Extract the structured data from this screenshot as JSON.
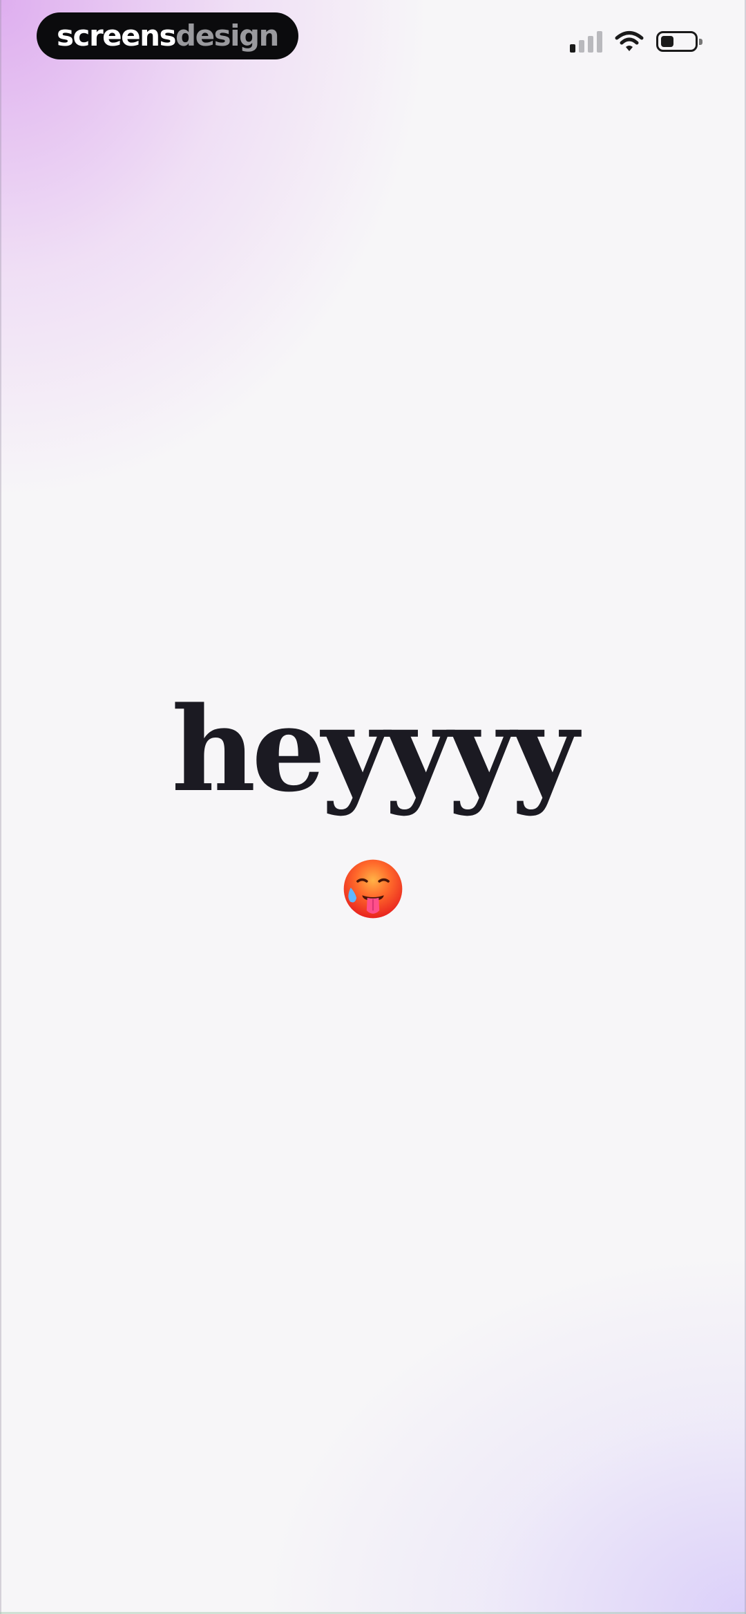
{
  "brand": {
    "part1": "screens",
    "part2": "design"
  },
  "status_bar": {
    "icons": [
      "cellular-signal-icon",
      "wifi-icon",
      "battery-icon"
    ],
    "signal_bars_active": 1,
    "signal_bars_total": 4,
    "battery_level": 0.4
  },
  "main": {
    "greeting": "heyyyy",
    "emoji": "hot-face-icon"
  },
  "colors": {
    "text": "#1b1a22",
    "pill_bg": "#0b0b0d",
    "pill_text_primary": "#ffffff",
    "pill_text_secondary": "#9a9a9e",
    "gradient_top_left": "#d696ec",
    "gradient_bottom_right": "#d2c3fa",
    "background": "#f7f6f8"
  }
}
